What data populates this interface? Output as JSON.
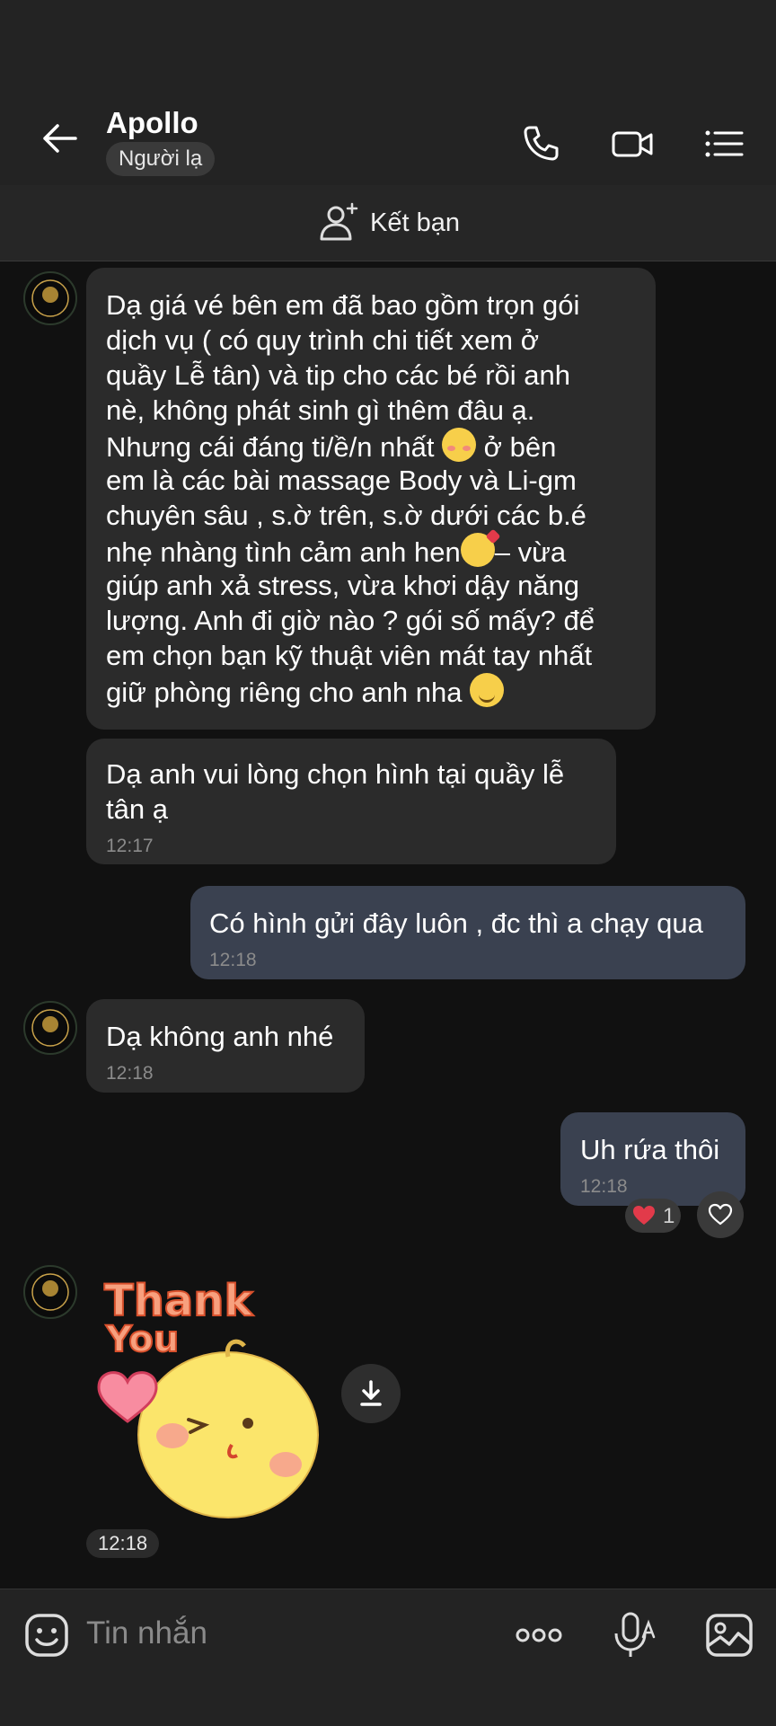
{
  "header": {
    "title": "Apollo",
    "badge": "Người lạ",
    "add_friend_label": "Kết bạn"
  },
  "messages": [
    {
      "id": "m1",
      "direction": "in",
      "line1": "Dạ giá vé bên em đã bao gồm trọn gói",
      "line2": "dịch vụ ( có quy trình chi tiết xem ở",
      "line3": "quầy Lễ tân) và tip cho các bé rồi anh",
      "line4": "nè, không phát sinh gì thêm đâu ạ.",
      "line5a": "Nhưng cái đáng ti/ề/n nhất ",
      "line5b": " ở bên",
      "line6": "em là các bài massage Body và Li-gm",
      "line7": "chuyên sâu , s.ờ trên, s.ờ dưới các b.é",
      "line8a": "nhẹ nhàng tình cảm anh hen",
      "line8b": "– vừa",
      "line9": "giúp anh xả stress, vừa khơi dậy năng",
      "line10": "lượng. Anh đi giờ nào ? gói số mấy? để",
      "line11": "em chọn bạn kỹ thuật viên mát tay nhất",
      "line12": "giữ phòng riêng cho anh nha"
    },
    {
      "id": "m2",
      "direction": "in",
      "line1": "Dạ anh vui lòng chọn hình tại quầy lễ",
      "line2": "tân ạ",
      "time": "12:17"
    },
    {
      "id": "m3",
      "direction": "out",
      "text": "Có hình gửi đây luôn , đc thì a chạy qua",
      "time": "12:18"
    },
    {
      "id": "m4",
      "direction": "in",
      "text": "Dạ không anh nhé",
      "time": "12:18"
    },
    {
      "id": "m5",
      "direction": "out",
      "text": "Uh rứa thôi",
      "time": "12:18",
      "reaction_count": "1"
    },
    {
      "id": "m6",
      "direction": "in",
      "sticker_text_1": "Thank",
      "sticker_text_2": "You",
      "time": "12:18"
    }
  ],
  "composer": {
    "placeholder": "Tin nhắn"
  },
  "colors": {
    "background": "#111111",
    "header": "#232323",
    "incoming_bubble": "#2b2b2b",
    "outgoing_bubble": "#3a4150",
    "reaction_heart": "#e23a4a"
  },
  "icons": {
    "back": "arrow-left-icon",
    "call": "phone-icon",
    "video": "video-camera-icon",
    "menu": "list-menu-icon",
    "add_friend": "add-user-icon",
    "download": "download-icon",
    "emoji": "emoji-icon",
    "more": "more-dots-icon",
    "voice": "microphone-icon",
    "image": "image-icon"
  }
}
